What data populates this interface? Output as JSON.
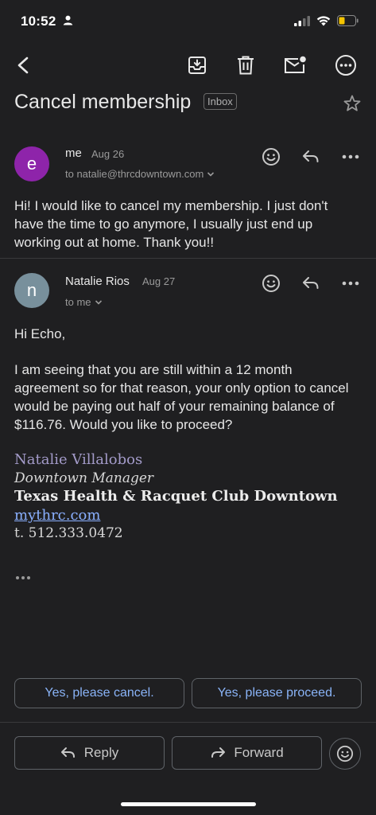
{
  "status_bar": {
    "time": "10:52"
  },
  "thread": {
    "subject": "Cancel membership",
    "label": "Inbox"
  },
  "messages": [
    {
      "avatar_letter": "e",
      "avatar_color": "#8e24aa",
      "sender": "me",
      "date": "Aug 26",
      "recipients": "to natalie@thrcdowntown.com",
      "body": "Hi! I would like to cancel my membership. I just don't have the time to go anymore, I usually just end up working out at home. Thank you!!"
    },
    {
      "avatar_letter": "n",
      "avatar_color": "#78909c",
      "sender": "Natalie Rios",
      "date": "Aug 27",
      "recipients": "to me",
      "greeting": "Hi Echo,",
      "body": "I am seeing that you are still within a 12 month agreement so for that reason, your only option to cancel would be paying out half of your remaining balance of $116.76. Would you like to proceed?",
      "signature": {
        "name": "Natalie Villalobos",
        "title": "Downtown Manager",
        "organization": "Texas Health & Racquet Club Downtown",
        "website": "mythrc.com",
        "phone": "t. 512.333.0472"
      }
    }
  ],
  "smart_replies": [
    "Yes, please cancel.",
    "Yes, please proceed."
  ],
  "bottom_actions": {
    "reply": "Reply",
    "forward": "Forward"
  },
  "colors": {
    "background": "#1f1f21",
    "accent": "#8ab4f8",
    "signature_name": "#a39bc9"
  }
}
